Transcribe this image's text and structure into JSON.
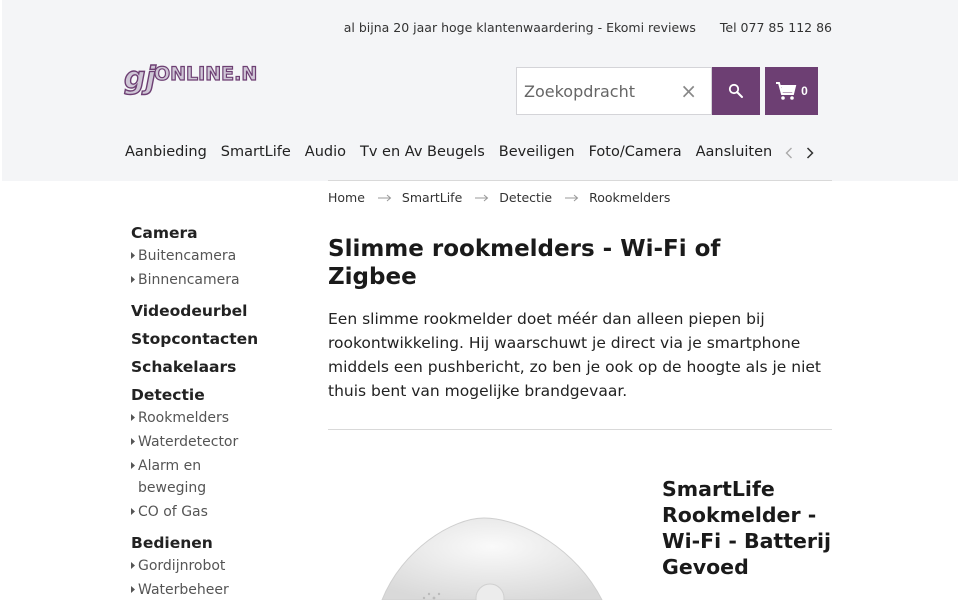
{
  "topbar": {
    "reviews": "al bijna 20 jaar hoge klantenwaardering - Ekomi reviews",
    "phone": "Tel 077 85 112 86"
  },
  "logo_text": "GJONLINE.NL",
  "search": {
    "placeholder": "Zoekopdracht",
    "clear_icon": "×"
  },
  "cart": {
    "count": "0"
  },
  "nav": {
    "items": [
      "Aanbieding",
      "SmartLife",
      "Audio",
      "Tv en Av Beugels",
      "Beveiligen",
      "Foto/Camera",
      "Aansluiten"
    ]
  },
  "breadcrumb": [
    "Home",
    "SmartLife",
    "Detectie",
    "Rookmelders"
  ],
  "sidebar": {
    "camera": {
      "label": "Camera",
      "subs": [
        "Buitencamera",
        "Binnencamera"
      ]
    },
    "videodeurbel": "Videodeurbel",
    "stopcontacten": "Stopcontacten",
    "schakelaars": "Schakelaars",
    "detectie": {
      "label": "Detectie",
      "subs": [
        "Rookmelders",
        "Waterdetector",
        "Alarm en beweging",
        "CO of Gas"
      ]
    },
    "bedienen": {
      "label": "Bedienen",
      "subs": [
        "Gordijnrobot",
        "Waterbeheer"
      ]
    }
  },
  "page": {
    "title": "Slimme rookmelders - Wi-Fi of Zigbee",
    "intro": "Een slimme rookmelder doet méér dan alleen piepen bij rookontwikkeling. Hij waarschuwt je direct via je smartphone middels een pushbericht, zo ben je ook op de hoogte als je niet thuis bent van mogelijke brandgevaar."
  },
  "product": {
    "title": "SmartLife Rookmelder - Wi-Fi - Batterij Gevoed"
  },
  "colors": {
    "brand_purple": "#6d3f73",
    "header_bg": "#f4f5f7"
  }
}
